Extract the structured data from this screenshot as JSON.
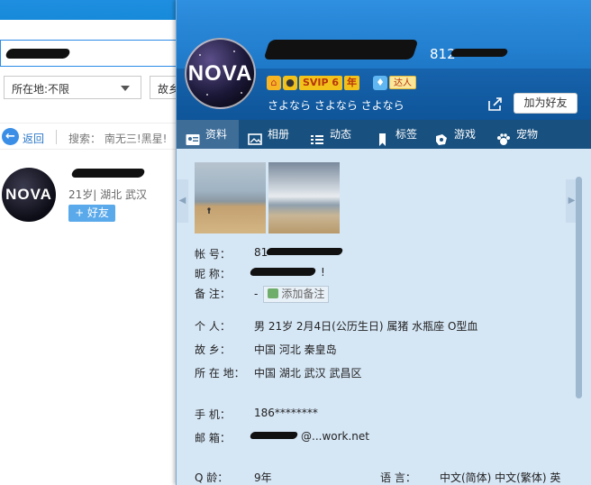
{
  "left_window": {
    "location_select": "所在地:不限",
    "hometown_select": "故乡",
    "back_label": "返回",
    "search_crumb": "搜索：  南无三!黑星!",
    "result": {
      "avatar_text": "NOVA",
      "meta": "21岁| 湖北 武汉",
      "add_friend_label": "+ 好友"
    }
  },
  "profile_card": {
    "avatar_text": "NOVA",
    "uin_partial": "812",
    "badges": {
      "vip_label": "SVIP 6",
      "vip_year_label": "年",
      "talent_label": "达人"
    },
    "signature": "さよなら さよなら さよなら",
    "add_friend_label": "加为好友",
    "tabs": [
      {
        "label": "资料",
        "icon": "profile-card-icon",
        "active": true
      },
      {
        "label": "相册",
        "icon": "album-icon",
        "active": false
      },
      {
        "label": "动态",
        "icon": "feed-list-icon",
        "active": false
      },
      {
        "label": "标签",
        "icon": "bookmark-icon",
        "active": false
      },
      {
        "label": "游戏",
        "icon": "game-icon",
        "active": false
      },
      {
        "label": "宠物",
        "icon": "pet-paw-icon",
        "active": false
      }
    ],
    "info": {
      "account_label": "帐     号：",
      "account_value": "81",
      "nickname_label": "昵     称：",
      "nickname_value": "!",
      "remark_label": "备     注：",
      "remark_dash": "-",
      "remark_button": "添加备注",
      "personal_label": "个     人：",
      "personal_value": "男   21岁   2月4日(公历生日)   属猪   水瓶座   O型血",
      "hometown_label": "故     乡：",
      "hometown_value": "中国 河北 秦皇岛",
      "location_label": "所 在 地：",
      "location_value": "中国 湖北 武汉 武昌区",
      "phone_label": "手     机：",
      "phone_value": "186********",
      "email_label": "邮     箱：",
      "email_value": "@...work.net",
      "qage_label": "Q     龄：",
      "qage_value": "9年",
      "language_label": "语     言：",
      "language_value": "中文(简体)  中文(繁体)  英"
    }
  }
}
